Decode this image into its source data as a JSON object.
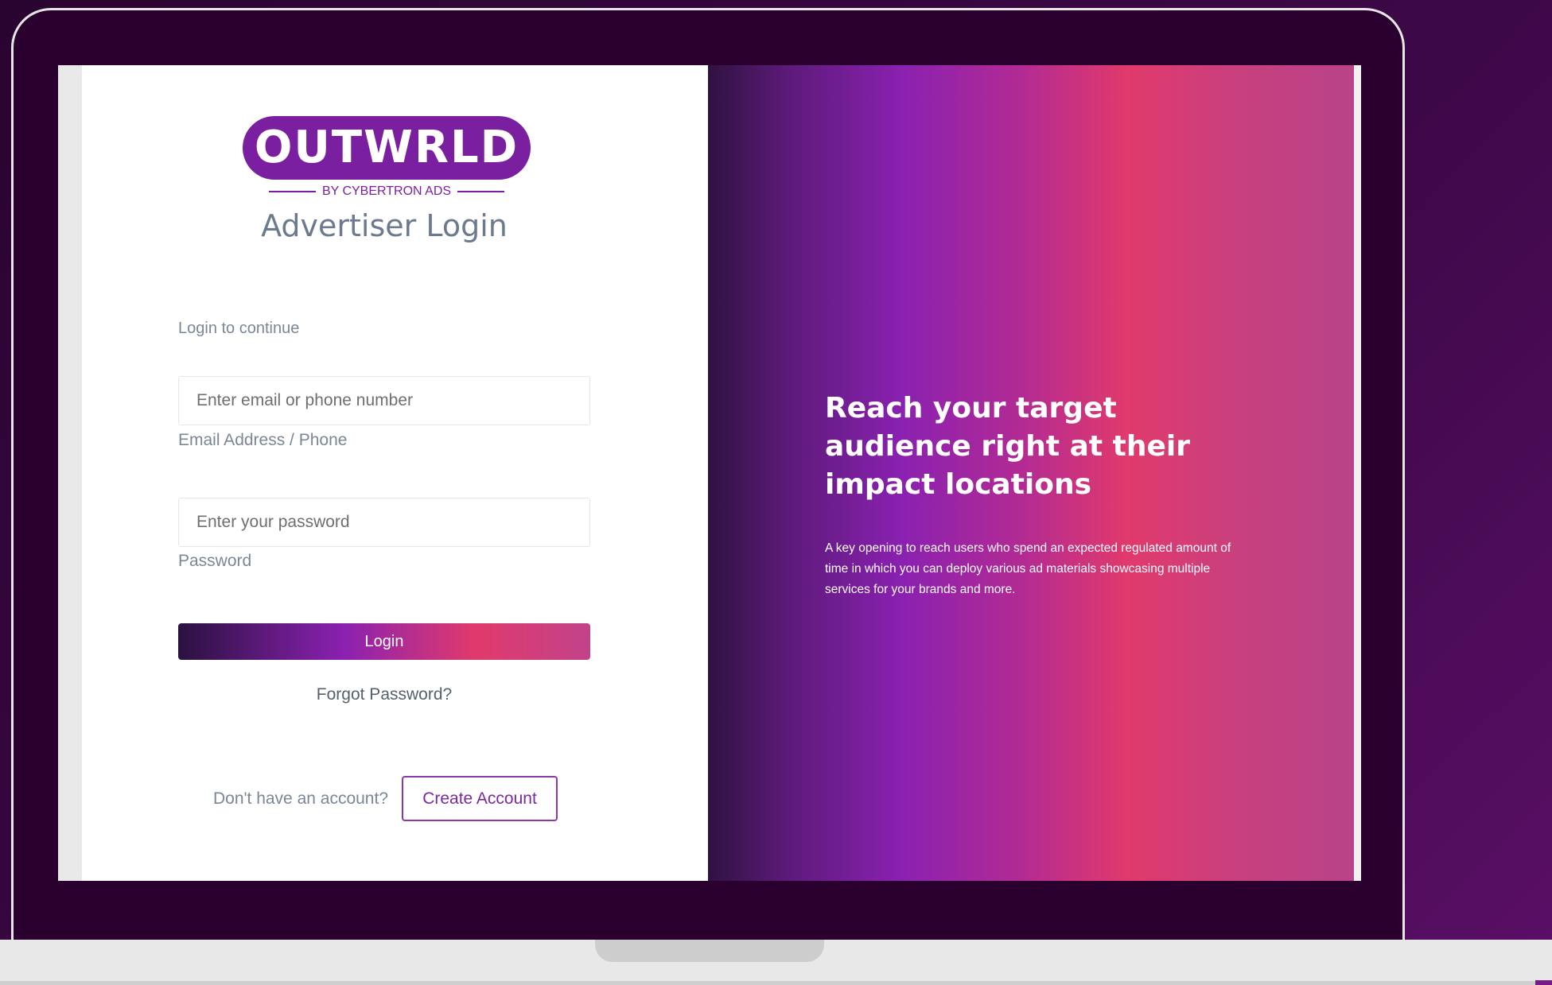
{
  "logo": {
    "wordmark": "OUTWRLD",
    "tagline": "BY CYBERTRON ADS"
  },
  "login": {
    "title": "Advertiser Login",
    "hint": "Login to continue",
    "email": {
      "placeholder": "Enter email or phone number",
      "value": "",
      "label": "Email Address / Phone"
    },
    "password": {
      "placeholder": "Enter your password",
      "value": "",
      "label": "Password"
    },
    "submit_label": "Login",
    "forgot_label": "Forgot Password?",
    "no_account_text": "Don't have an account?",
    "create_account_label": "Create Account"
  },
  "hero": {
    "title": "Reach your target audience right at their impact locations",
    "description": "A key opening to reach users who spend an expected regulated amount of time in which you can deploy various ad materials showcasing multiple services for your brands and more."
  },
  "colors": {
    "brand_purple": "#7a1fa0",
    "gradient_start": "#2b1140",
    "gradient_mid": "#8a21b0",
    "gradient_pink": "#e13a6c",
    "background": "#2a0430"
  }
}
